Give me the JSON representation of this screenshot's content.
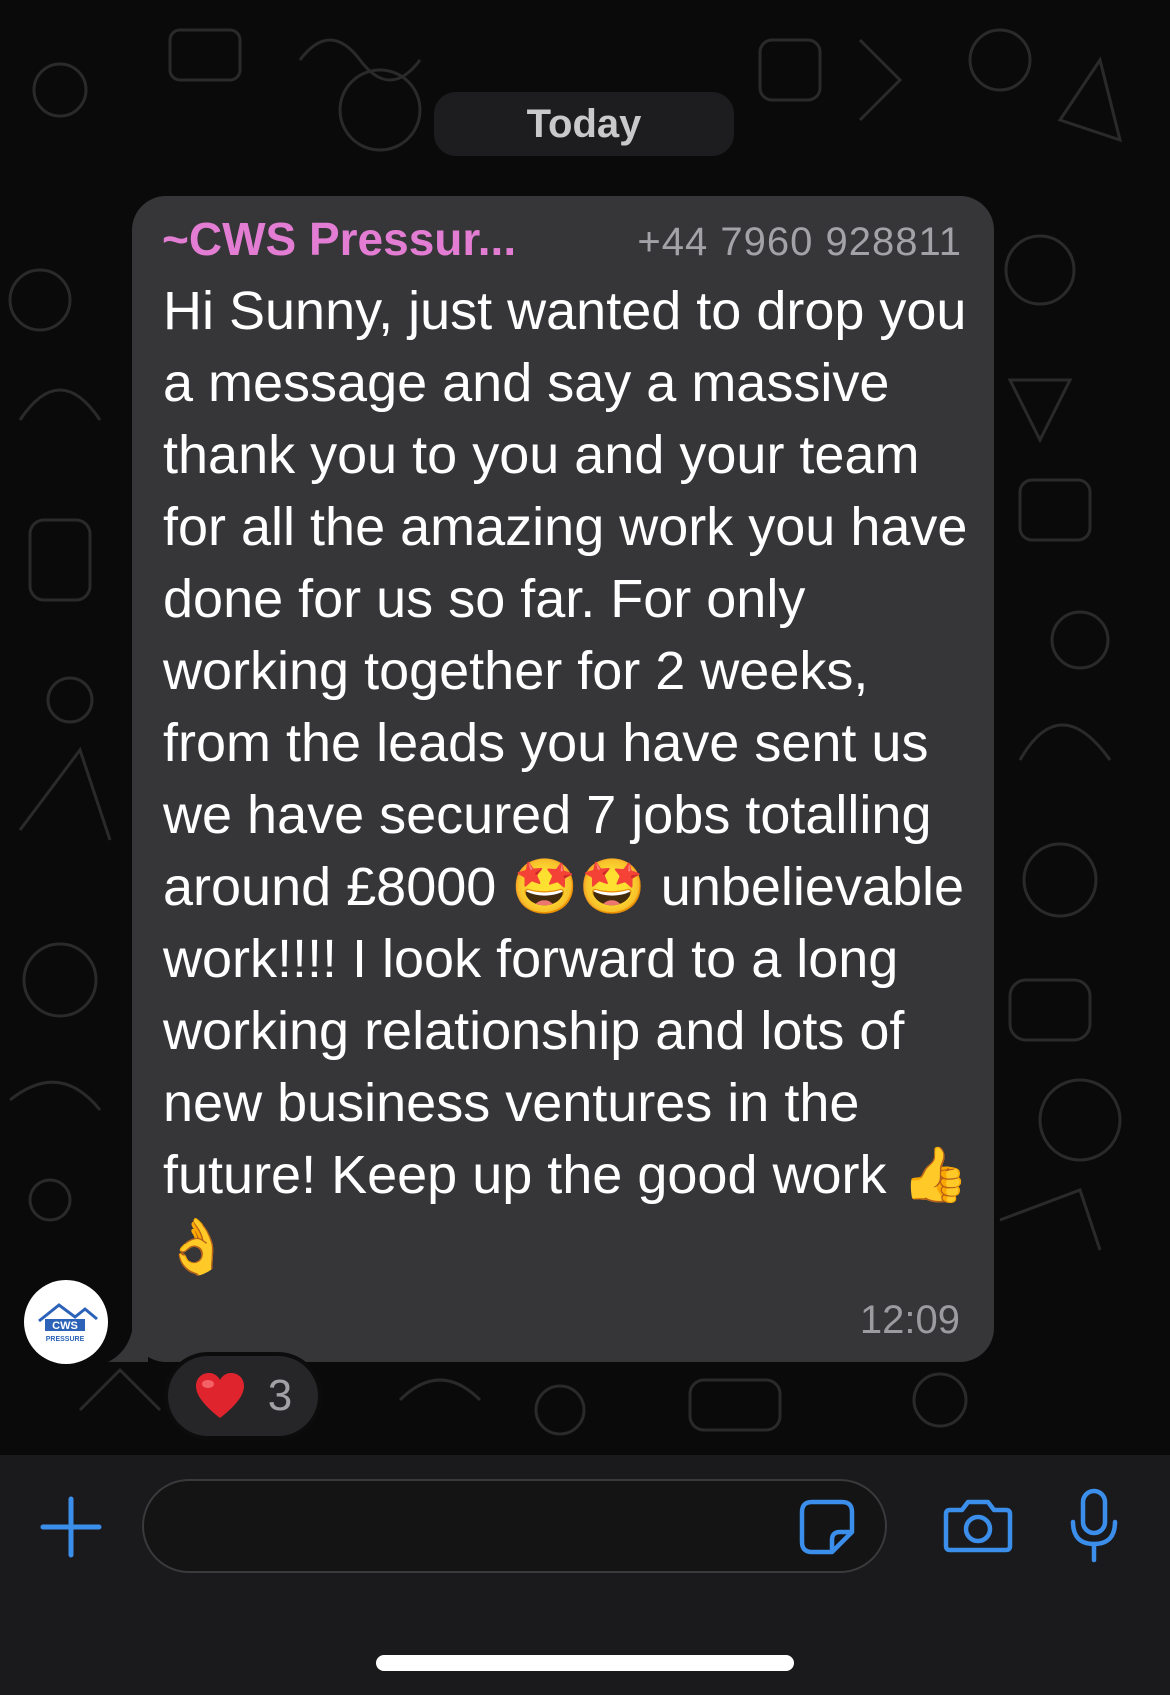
{
  "chat": {
    "date_separator": "Today"
  },
  "message": {
    "sender_name": "~CWS Pressur...",
    "sender_phone": "+44 7960 928811",
    "text": "Hi Sunny, just wanted to drop you a message and say a massive thank you to you and your team for all the amazing work you have done for us so far. For only working together for 2 weeks, from the leads you have sent us we have secured 7 jobs totalling around £8000 🤩🤩 unbelievable work!!!! I look forward to a long working relationship and lots of new business ventures in the future! Keep up the good work 👍👌",
    "time": "12:09",
    "reaction": {
      "emoji": "❤️",
      "count": "3"
    }
  },
  "avatar": {
    "logo_text": "CWS",
    "logo_subtext": "PRESSURE"
  },
  "input": {
    "placeholder": ""
  },
  "icons": {
    "attach": "plus-icon",
    "sticker": "sticker-icon",
    "camera": "camera-icon",
    "mic": "microphone-icon"
  },
  "colors": {
    "accent": "#3b8eea",
    "sender_name": "#e37dd3",
    "bubble": "#363638",
    "heart": "#e0242e"
  }
}
